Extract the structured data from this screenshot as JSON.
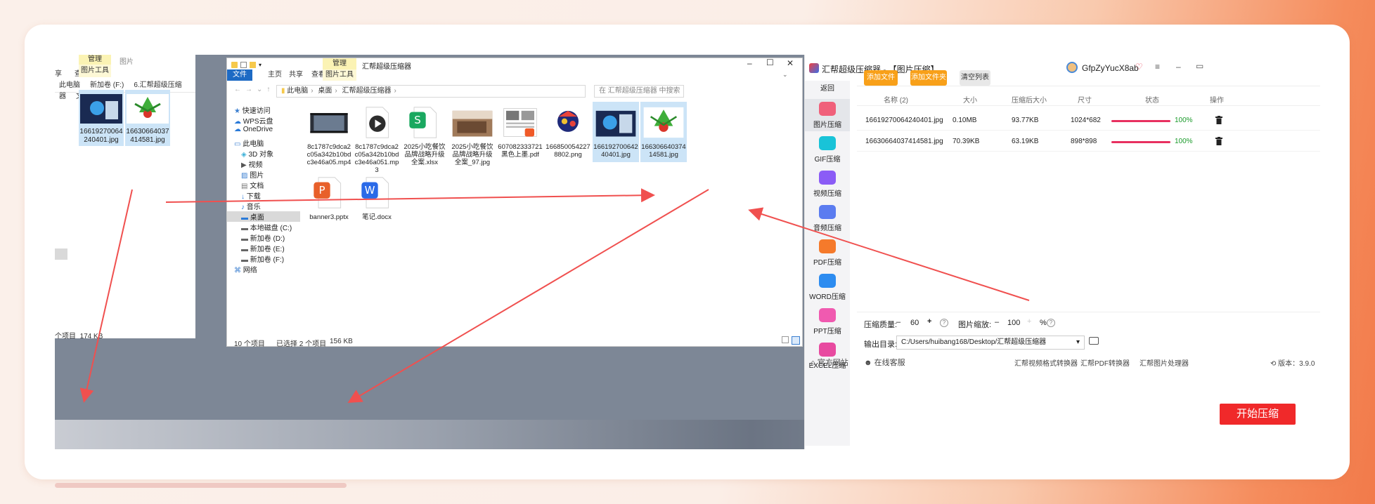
{
  "back_window": {
    "ribbon_left": "享",
    "ribbon_view": "查看",
    "manage_tab": "管理",
    "picture_tab": "图片",
    "picture_tools": "图片工具",
    "breadcrumb": [
      "此电脑",
      "新加卷 (F:)",
      "6.汇帮超级压缩器",
      "文件"
    ],
    "files": [
      {
        "name": "16619270064240401.jpg"
      },
      {
        "name": "16630664037414581.jpg"
      }
    ],
    "status_count": "个项目",
    "status_size": "174 KB"
  },
  "explorer": {
    "title": "汇帮超级压缩器",
    "manage_tab": "管理",
    "picture_tools": "图片工具",
    "ribbon_tabs": [
      "文件",
      "主页",
      "共享",
      "查看"
    ],
    "breadcrumb": [
      "此电脑",
      "桌面",
      "汇帮超级压缩器"
    ],
    "search_placeholder": "在 汇帮超级压缩器 中搜索",
    "nav": [
      {
        "label": "快速访问",
        "icon": "star-icon",
        "indent": 0
      },
      {
        "label": "WPS云盘",
        "icon": "cloud-icon",
        "indent": 0
      },
      {
        "label": "OneDrive",
        "icon": "cloud-icon",
        "indent": 0
      },
      {
        "label": "此电脑",
        "icon": "computer-icon",
        "indent": 0
      },
      {
        "label": "3D 对象",
        "icon": "cube-icon",
        "indent": 1
      },
      {
        "label": "视频",
        "icon": "video-icon",
        "indent": 1
      },
      {
        "label": "图片",
        "icon": "picture-icon",
        "indent": 1
      },
      {
        "label": "文档",
        "icon": "document-icon",
        "indent": 1
      },
      {
        "label": "下载",
        "icon": "download-icon",
        "indent": 1
      },
      {
        "label": "音乐",
        "icon": "music-icon",
        "indent": 1
      },
      {
        "label": "桌面",
        "icon": "desktop-icon",
        "indent": 1,
        "selected": true
      },
      {
        "label": "本地磁盘 (C:)",
        "icon": "drive-icon",
        "indent": 1
      },
      {
        "label": "新加卷 (D:)",
        "icon": "drive-icon",
        "indent": 1
      },
      {
        "label": "新加卷 (E:)",
        "icon": "drive-icon",
        "indent": 1
      },
      {
        "label": "新加卷 (F:)",
        "icon": "drive-icon",
        "indent": 1
      },
      {
        "label": "网络",
        "icon": "network-icon",
        "indent": 0
      }
    ],
    "files": [
      {
        "name": "8c1787c9dca2c05a342b10bdc3e46a05.mp4",
        "type": "video",
        "selected": false
      },
      {
        "name": "8c1787c9dca2c05a342b10bdc3e46a051.mp3",
        "type": "audio",
        "selected": false
      },
      {
        "name": "2025小吃餐饮品牌战略升级全案.xlsx",
        "type": "xlsx",
        "selected": false
      },
      {
        "name": "2025小吃餐饮品牌战略升级全案_97.jpg",
        "type": "photo",
        "selected": false
      },
      {
        "name": "6070823337​21黑色上墨.pdf",
        "type": "pdf",
        "selected": false
      },
      {
        "name": "1668500542278802.png",
        "type": "png",
        "selected": false
      },
      {
        "name": "16619270064240401.jpg",
        "type": "photo2",
        "selected": true
      },
      {
        "name": "16630664037414581.jpg",
        "type": "zongzi",
        "selected": true
      },
      {
        "name": "banner3.pptx",
        "type": "pptx",
        "selected": false
      },
      {
        "name": "笔记.docx",
        "type": "docx",
        "selected": false
      }
    ],
    "status_items": "10 个项目",
    "status_selected": "已选择 2 个项目",
    "status_size": "156 KB"
  },
  "app": {
    "title": "汇帮超级压缩器  - 【图片压缩】",
    "username": "GfpZyYucX8ab",
    "back_label": "返回",
    "sidebar": [
      {
        "label": "图片压缩",
        "color": "#f0607a",
        "active": true
      },
      {
        "label": "GIF压缩",
        "color": "#19c3d8",
        "active": false
      },
      {
        "label": "视频压缩",
        "color": "#8b5cf6",
        "active": false
      },
      {
        "label": "音频压缩",
        "color": "#5b7cf0",
        "active": false
      },
      {
        "label": "PDF压缩",
        "color": "#f57a2b",
        "active": false
      },
      {
        "label": "WORD压缩",
        "color": "#2d8cf0",
        "active": false
      },
      {
        "label": "PPT压缩",
        "color": "#f05ab0",
        "active": false
      },
      {
        "label": "EXCEL压缩",
        "color": "#e84aa0",
        "active": false
      }
    ],
    "buttons": {
      "add_file": "添加文件",
      "add_folder": "添加文件夹",
      "clear_list": "清空列表",
      "start": "开始压缩"
    },
    "columns": [
      "名称 (2)",
      "大小",
      "压缩后大小",
      "尺寸",
      "状态",
      "操作"
    ],
    "rows": [
      {
        "name": "16619270064240401.jpg",
        "size": "0.10MB",
        "compressed": "93.77KB",
        "dims": "1024*682",
        "progress": 1.0,
        "percent": "100%"
      },
      {
        "name": "16630664037414581.jpg",
        "size": "70.39KB",
        "compressed": "63.19KB",
        "dims": "898*898",
        "progress": 1.0,
        "percent": "100%"
      }
    ],
    "quality_label": "压缩质量:",
    "quality_value": "60",
    "scale_label": "图片缩放:",
    "scale_value": "100",
    "percent_sign": "%",
    "output_label": "输出目录:",
    "output_path": "C:/Users/huibang168/Desktop/汇帮超级压缩器",
    "footer": {
      "website": "官方网站",
      "service": "在线客服",
      "link1": "汇帮视频格式转换器",
      "link2": "汇帮PDF转换器",
      "link3": "汇帮图片处理器",
      "version": "版本：3.9.0"
    }
  },
  "colors": {
    "arrow": "#f0504f",
    "accent_orange": "#f8a019",
    "start_red": "#f0292a",
    "progress": "#e83060",
    "selection": "#cce4f7"
  }
}
